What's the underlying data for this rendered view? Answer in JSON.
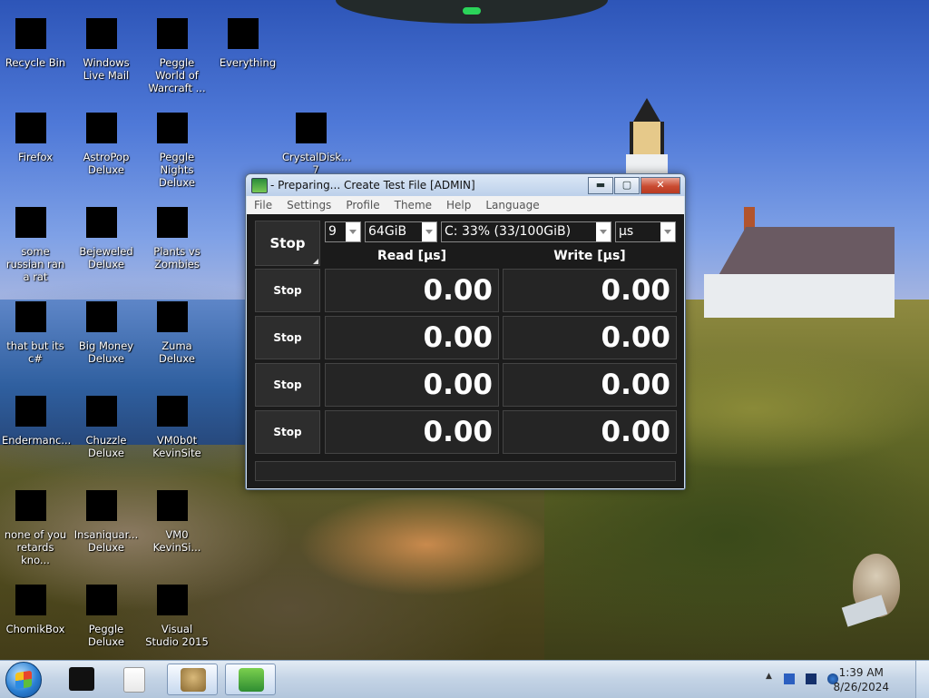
{
  "desktop": {
    "icons": [
      {
        "label": "Recycle Bin",
        "icon": "recycle-bin-icon"
      },
      {
        "label": "Windows Live Mail",
        "icon": "mail-icon"
      },
      {
        "label": "Peggle World of Warcraft ...",
        "icon": "game-icon"
      },
      {
        "label": "Everything",
        "icon": "search-icon"
      },
      {
        "label": "Firefox",
        "icon": "firefox-icon"
      },
      {
        "label": "AstroPop Deluxe",
        "icon": "game-icon"
      },
      {
        "label": "Peggle Nights Deluxe",
        "icon": "game-icon"
      },
      {
        "label": "CrystalDisk... 7",
        "icon": "disk-icon"
      },
      {
        "label": "some russian ran a rat",
        "icon": "app-icon"
      },
      {
        "label": "Bejeweled Deluxe",
        "icon": "game-icon"
      },
      {
        "label": "Plants vs Zombies",
        "icon": "game-icon"
      },
      {
        "label": "that but its c#",
        "icon": "app-icon"
      },
      {
        "label": "Big Money Deluxe",
        "icon": "game-icon"
      },
      {
        "label": "Zuma Deluxe",
        "icon": "game-icon"
      },
      {
        "label": "Endermanc...",
        "icon": "app-icon"
      },
      {
        "label": "Chuzzle Deluxe",
        "icon": "game-icon"
      },
      {
        "label": "VM0b0t KevinSite",
        "icon": "app-icon"
      },
      {
        "label": "none of you retards kno...",
        "icon": "browser-icon"
      },
      {
        "label": "Insaniquar... Deluxe",
        "icon": "game-icon"
      },
      {
        "label": "VM0 KevinSi...",
        "icon": "app-icon"
      },
      {
        "label": "ChomikBox",
        "icon": "hamster-icon"
      },
      {
        "label": "Peggle Deluxe",
        "icon": "game-icon"
      },
      {
        "label": "Visual Studio 2015",
        "icon": "visual-studio-icon"
      }
    ]
  },
  "window": {
    "title": "- Preparing... Create Test File [ADMIN]",
    "buttons": {
      "minimize": "▬",
      "maximize": "▢",
      "close": "✕"
    },
    "menu": [
      "File",
      "Settings",
      "Profile",
      "Theme",
      "Help",
      "Language"
    ],
    "main_button": "Stop",
    "controls": {
      "count": "9",
      "size": "64GiB",
      "drive": "C: 33% (33/100GiB)",
      "unit": "µs"
    },
    "headers": {
      "read": "Read [µs]",
      "write": "Write [µs]"
    },
    "rows": [
      {
        "button": "Stop",
        "read": "0.00",
        "write": "0.00"
      },
      {
        "button": "Stop",
        "read": "0.00",
        "write": "0.00"
      },
      {
        "button": "Stop",
        "read": "0.00",
        "write": "0.00"
      },
      {
        "button": "Stop",
        "read": "0.00",
        "write": "0.00"
      }
    ],
    "status": ""
  },
  "taskbar": {
    "time": "1:39 AM",
    "date": "8/26/2024",
    "tray_arrow": "▲"
  }
}
